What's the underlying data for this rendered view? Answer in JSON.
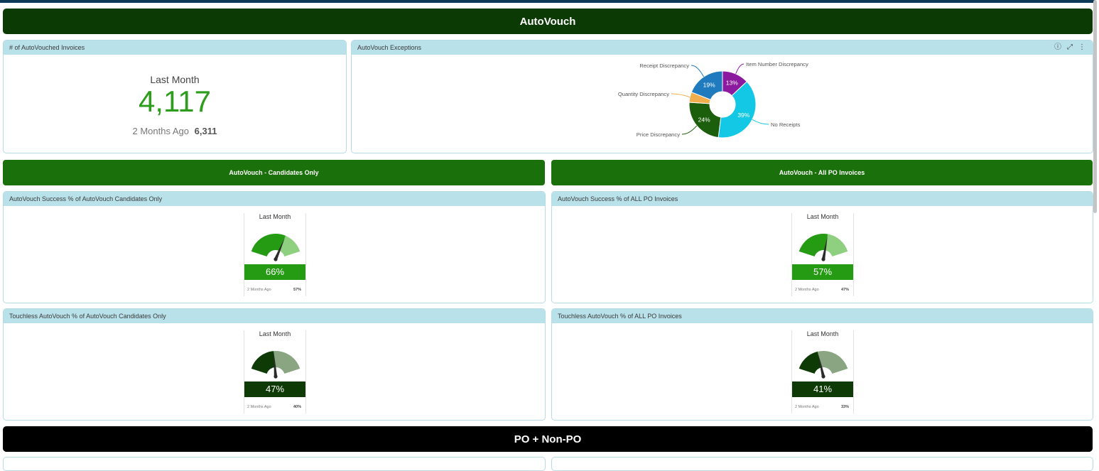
{
  "autovouch_header": "AutoVouch",
  "po_header": "PO + Non-PO",
  "invoices_card": {
    "title": "# of AutoVouched Invoices",
    "period": "Last Month",
    "value": "4,117",
    "prev_label": "2 Months Ago",
    "prev_value": "6,311"
  },
  "exceptions_card": {
    "title": "AutoVouch Exceptions",
    "icons": [
      "info-icon",
      "expand-icon",
      "more-vertical-icon"
    ],
    "info_glyph": "ⓘ",
    "expand_glyph": "⤢",
    "more_glyph": "⋮"
  },
  "chart_data": {
    "type": "pie",
    "donut": true,
    "categories": [
      "Item Number Discrepancy",
      "No Receipts",
      "Price Discrepancy",
      "Quantity Discrepancy",
      "Receipt Discrepancy"
    ],
    "values": [
      13,
      39,
      24,
      5,
      19
    ],
    "labels": [
      "13%",
      "39%",
      "24%",
      "",
      "19%"
    ],
    "colors": [
      "#8c1a9e",
      "#13c8e4",
      "#1b5e0b",
      "#f2ae4d",
      "#1f7bbd"
    ]
  },
  "candidates_bar": "AutoVouch - Candidates Only",
  "all_po_bar": "AutoVouch - All PO Invoices",
  "gauges": [
    {
      "title": "AutoVouch Success % of AutoVouch Candidates Only",
      "period": "Last Month",
      "value": "66%",
      "pct": 0.66,
      "prev_label": "2 Months Ago",
      "prev_value": "57%",
      "scheme": "success"
    },
    {
      "title": "AutoVouch Success % of ALL PO Invoices",
      "period": "Last Month",
      "value": "57%",
      "pct": 0.57,
      "prev_label": "2 Months Ago",
      "prev_value": "47%",
      "scheme": "success"
    },
    {
      "title": "Touchless AutoVouch % of AutoVouch Candidates Only",
      "period": "Last Month",
      "value": "47%",
      "pct": 0.47,
      "prev_label": "2 Months Ago",
      "prev_value": "40%",
      "scheme": "touchless"
    },
    {
      "title": "Touchless AutoVouch % of ALL PO Invoices",
      "period": "Last Month",
      "value": "41%",
      "pct": 0.41,
      "prev_label": "2 Months Ago",
      "prev_value": "33%",
      "scheme": "touchless"
    }
  ],
  "colors": {
    "success_fill": "#259b14",
    "success_rest": "#8fcf80",
    "touchless_fill": "#0d3a05",
    "touchless_rest": "#8aa581",
    "success_band": "#259b14",
    "touchless_band": "#0d3a05",
    "kpi_value": "#2e9c1c"
  }
}
